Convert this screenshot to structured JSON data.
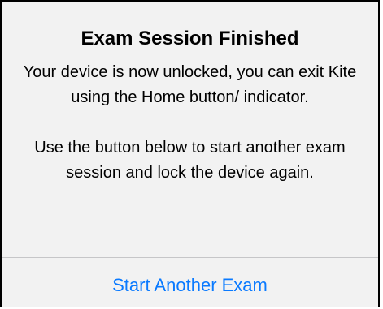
{
  "dialog": {
    "title": "Exam Session Finished",
    "message_line_1": "Your device is now unlocked, you can exit Kite using the Home button/ indicator.",
    "message_line_2": "Use the button below to start another exam session and lock the device again.",
    "action_label": "Start Another Exam",
    "colors": {
      "background": "#f2f2f2",
      "border": "#000000",
      "action_text": "#0a7aff",
      "divider": "#c6c6c8"
    }
  }
}
